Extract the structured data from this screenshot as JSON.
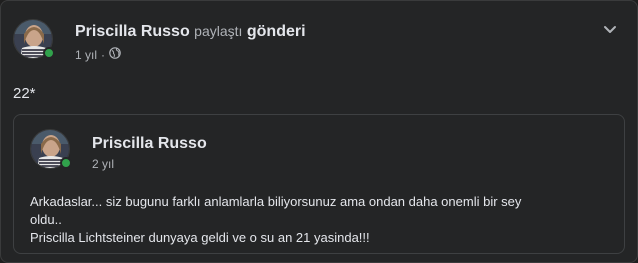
{
  "post": {
    "author": "Priscilla Russo",
    "action": "paylaştı",
    "object": "gönderi",
    "time": "1 yıl",
    "separator": "·",
    "privacy_icon": "globe-icon",
    "options_icon": "chevron-down-icon",
    "text": "22*"
  },
  "shared_post": {
    "author": "Priscilla Russo",
    "time": "2 yıl",
    "lines": [
      "Arkadaslar... siz bugunu farklı anlamlarla biliyorsunuz ama ondan daha onemli bir sey",
      "oldu..",
      "Priscilla Lichtsteiner dunyaya geldi ve o su an 21 yasinda!!!"
    ]
  },
  "colors": {
    "background": "#242526",
    "text_primary": "#e4e6eb",
    "text_secondary": "#b0b3b8",
    "online": "#31a24c",
    "border": "#3e4042"
  }
}
